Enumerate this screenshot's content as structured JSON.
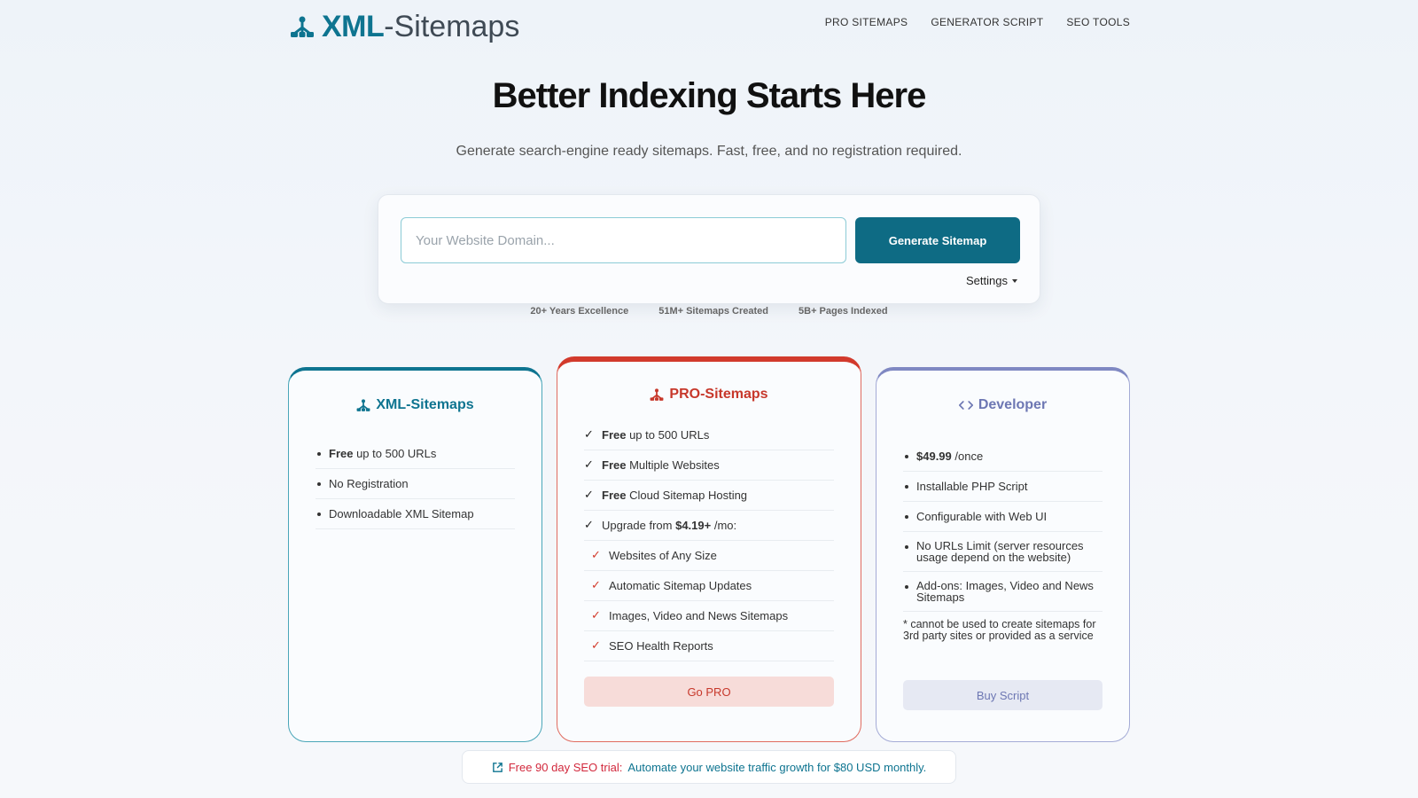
{
  "header": {
    "logo_bold": "XML",
    "logo_light": "-Sitemaps",
    "nav": [
      "PRO SITEMAPS",
      "GENERATOR SCRIPT",
      "SEO TOOLS"
    ]
  },
  "hero": {
    "title": "Better Indexing Starts Here",
    "subtitle": "Generate search-engine ready sitemaps. Fast, free, and no registration required."
  },
  "search": {
    "placeholder": "Your Website Domain...",
    "value": "",
    "button_label": "Generate Sitemap",
    "settings_label": "Settings"
  },
  "stats": [
    "20+ Years Excellence",
    "51M+ Sitemaps Created",
    "5B+ Pages Indexed"
  ],
  "cards": {
    "xml": {
      "title": "XML-Sitemaps",
      "features": [
        {
          "bold": "Free",
          "text": " up to 500 URLs"
        },
        {
          "bold": "",
          "text": "No Registration"
        },
        {
          "bold": "",
          "text": "Downloadable XML Sitemap"
        }
      ]
    },
    "pro": {
      "title": "PRO-Sitemaps",
      "features": [
        {
          "bold": "Free",
          "text": " up to 500 URLs"
        },
        {
          "bold": "Free",
          "text": " Multiple Websites"
        },
        {
          "bold": "Free",
          "text": " Cloud Sitemap Hosting"
        }
      ],
      "upgrade": {
        "prefix": "Upgrade from ",
        "price": "$4.19+",
        "suffix": " /mo:"
      },
      "sub_features": [
        "Websites of Any Size",
        "Automatic Sitemap Updates",
        "Images, Video and News Sitemaps",
        "SEO Health Reports"
      ],
      "button_label": "Go PRO"
    },
    "dev": {
      "title": "Developer",
      "price": {
        "bold": "$49.99",
        "text": " /once"
      },
      "features": [
        "Installable PHP Script",
        "Configurable with Web UI",
        "No URLs Limit (server resources usage depend on the website)",
        "Add-ons: Images, Video and News Sitemaps"
      ],
      "note": "* cannot be used to create sitemaps for 3rd party sites or provided as a service",
      "button_label": "Buy Script"
    }
  },
  "trial": {
    "red": "Free 90 day SEO trial:",
    "teal": "Automate your website traffic growth for $80 USD monthly."
  },
  "colors": {
    "brand_teal": "#0e7490",
    "pro_red": "#d23a2c",
    "dev_purple": "#7f88c2"
  },
  "icons": {
    "logo": "sitemap-tree-icon",
    "dev": "code-brackets-icon",
    "trial": "external-link-icon",
    "check": "check-icon"
  }
}
